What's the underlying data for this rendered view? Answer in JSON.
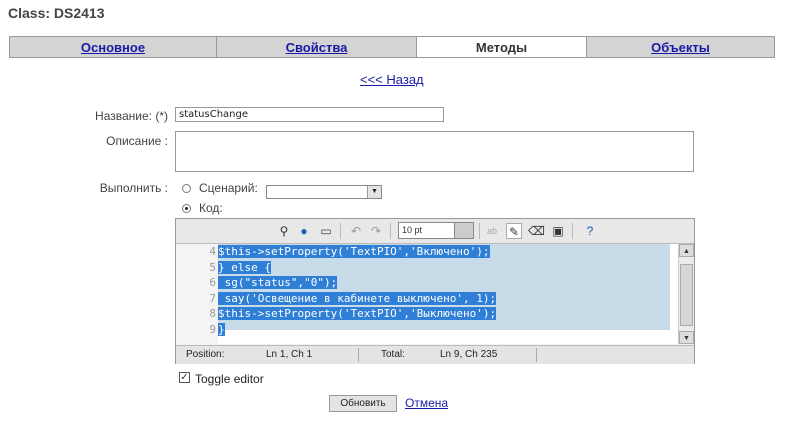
{
  "class_title": "Class: DS2413",
  "tabs": [
    {
      "label": "Основное",
      "active": false
    },
    {
      "label": "Свойства",
      "active": false
    },
    {
      "label": "Методы",
      "active": true
    },
    {
      "label": "Объекты",
      "active": false
    }
  ],
  "back_link": "<<< Назад",
  "form": {
    "name_label": "Название: (*)",
    "name_value": "statusChange",
    "description_label": "Описание :",
    "description_value": "",
    "execute_label": "Выполнить :",
    "scenario_label": "Сценарий:",
    "scenario_value": "",
    "code_label": "Код:"
  },
  "editor": {
    "font_size": "10 pt",
    "line_numbers": [
      "4",
      "5",
      "6",
      "7",
      "8",
      "9"
    ],
    "lines": [
      "$this->setProperty('TextPIO','Включено');",
      "} else {",
      " sg(\"status\",\"0\");",
      " say('Освещение в кабинете выключено', 1);",
      "$this->setProperty('TextPIO','Выключено');",
      "}"
    ],
    "status": {
      "position_label": "Position:",
      "position_value": "Ln 1, Ch 1",
      "total_label": "Total:",
      "total_value": "Ln 9, Ch 235"
    },
    "selection_color": "#2f7fd6"
  },
  "toggle_editor_label": "Toggle editor",
  "update_button": "Обновить",
  "cancel_link": "Отмена",
  "link_color": "#1a1aa6"
}
